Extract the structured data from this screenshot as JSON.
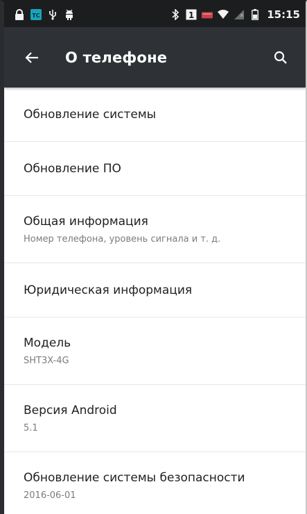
{
  "status_bar": {
    "icons": [
      "lock-icon",
      "app-tc-icon",
      "usb-icon",
      "android-debug-icon",
      "bluetooth-icon",
      "sim1-icon",
      "signal-icon",
      "wifi-icon",
      "no-signal-icon",
      "battery-icon"
    ],
    "sim_label": "1",
    "app_label": "TC",
    "time": "15:15"
  },
  "app_bar": {
    "title": "О телефоне",
    "back_icon": "arrow-back-icon",
    "search_icon": "search-icon"
  },
  "items": [
    {
      "title": "Обновление системы"
    },
    {
      "title": "Обновление ПО"
    },
    {
      "title": "Общая информация",
      "subtitle": "Номер телефона, уровень сигнала и т. д."
    },
    {
      "title": "Юридическая информация"
    },
    {
      "title": "Модель",
      "subtitle": "SHT3X-4G"
    },
    {
      "title": "Версия Android",
      "subtitle": "5.1"
    },
    {
      "title": "Обновление системы безопасности",
      "subtitle": "2016-06-01"
    }
  ],
  "colors": {
    "status_bar": "#1c1d1f",
    "app_bar": "#2e3236",
    "divider": "#e7e7e7",
    "title_text": "#212121",
    "subtitle_text": "#7b7b7b"
  }
}
